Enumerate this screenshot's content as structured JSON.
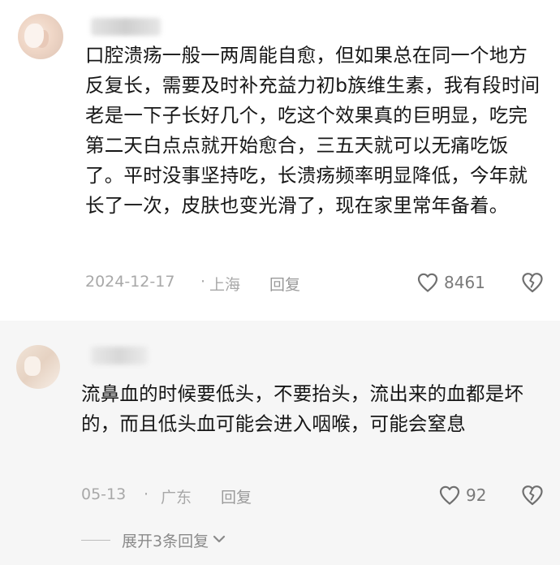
{
  "comments": [
    {
      "text": "口腔溃疡一般一两周能自愈，但如果总在同一个地方反复长，需要及时补充益力初b族维生素，我有段时间老是一下子长好几个，吃这个效果真的巨明显，吃完第二天白点点就开始愈合，三五天就可以无痛吃饭了。平时没事坚持吃，长溃疡频率明显降低，今年就长了一次，皮肤也变光滑了，现在家里常年备着。",
      "date": "2024-12-17",
      "separator": "·",
      "location": "上海",
      "reply_label": "回复",
      "likes": "8461",
      "avatar_icon": "user-avatar-icon",
      "username_blurred": true
    },
    {
      "text": "流鼻血的时候要低头，不要抬头，流出来的血都是坏的，而且低头血可能会进入咽喉，可能会窒息",
      "date": "05-13",
      "separator": "·",
      "location": "广东",
      "reply_label": "回复",
      "likes": "92",
      "avatar_icon": "user-avatar-icon",
      "username_blurred": true,
      "expand_label": "展开3条回复",
      "expand_icon": "chevron-down-icon"
    }
  ],
  "colors": {
    "text": "#161616",
    "meta": "#a8a8a8",
    "icon": "#7a7a7a",
    "second_bg": "#f6f6f6"
  }
}
